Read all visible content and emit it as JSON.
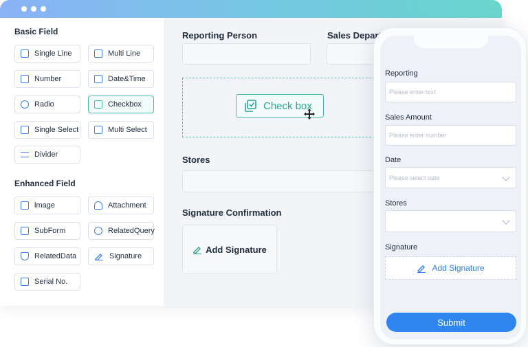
{
  "sidebar": {
    "basic_title": "Basic Field",
    "basic_items": [
      {
        "label": "Single Line",
        "icon": "single-line-icon"
      },
      {
        "label": "Multi Line",
        "icon": "multi-line-icon"
      },
      {
        "label": "Number",
        "icon": "number-icon"
      },
      {
        "label": "Date&Time",
        "icon": "calendar-icon"
      },
      {
        "label": "Radio",
        "icon": "radio-icon"
      },
      {
        "label": "Checkbox",
        "icon": "checkbox-icon",
        "active": true
      },
      {
        "label": "Single Select",
        "icon": "single-select-icon"
      },
      {
        "label": "Multi Select",
        "icon": "multi-select-icon"
      },
      {
        "label": "Divider",
        "icon": "divider-icon"
      }
    ],
    "enhanced_title": "Enhanced Field",
    "enhanced_items": [
      {
        "label": "lmage",
        "icon": "image-icon"
      },
      {
        "label": "Attachment",
        "icon": "upload-icon"
      },
      {
        "label": "SubForm",
        "icon": "subform-icon"
      },
      {
        "label": "RelatedQuery",
        "icon": "related-query-icon"
      },
      {
        "label": "RelatedData",
        "icon": "related-data-icon"
      },
      {
        "label": "Signature",
        "icon": "pen-icon"
      },
      {
        "label": "Serial No.",
        "icon": "serial-no-icon"
      }
    ]
  },
  "canvas": {
    "reporting_person": "Reporting Person",
    "sales_department": "Sales Departm",
    "dragged_field": "Check box",
    "stores": "Stores",
    "signature_confirmation": "Signature Confirmation",
    "add_signature": "Add Signature"
  },
  "phone": {
    "reporting_label": "Reporting",
    "reporting_placeholder": "Please enter text",
    "sales_amount_label": "Sales Amount",
    "sales_amount_placeholder": "Please enter number",
    "date_label": "Date",
    "date_placeholder": "Please select date",
    "stores_label": "Stores",
    "signature_label": "Signature",
    "add_signature": "Add Signature",
    "submit": "Submit"
  },
  "colors": {
    "accent_teal": "#47b8a7",
    "accent_blue": "#2f86ef",
    "titlebar_start": "#8ab2f6",
    "titlebar_end": "#69d6cc"
  }
}
